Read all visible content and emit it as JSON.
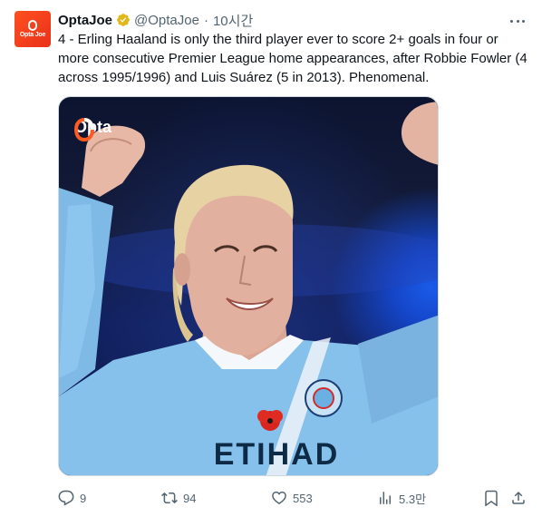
{
  "tweet": {
    "author_name": "OptaJoe",
    "handle": "@OptaJoe",
    "separator": "·",
    "time": "10시간",
    "text": "4 - Erling Haaland is only the third player ever to score 2+ goals in four or more consecutive Premier League home appearances, after Robbie Fowler (4 across 1995/1996) and Luis Suárez (5 in 2013). Phenomenal.",
    "avatar_label": "Opta Joe",
    "media_logo_text": "Opta",
    "jersey_text": "ETIHAD"
  },
  "actions": {
    "replies": "9",
    "retweets": "94",
    "likes": "553",
    "views": "5.3만"
  },
  "colors": {
    "accent_orange": "#ff4f1f",
    "verified_gold": "#e2b719",
    "muted_text": "#536471",
    "sky_blue_kit": "#86c1ec"
  },
  "icons": [
    "verified-badge-icon",
    "more-icon",
    "reply-icon",
    "retweet-icon",
    "like-icon",
    "views-icon",
    "bookmark-icon",
    "share-icon"
  ]
}
